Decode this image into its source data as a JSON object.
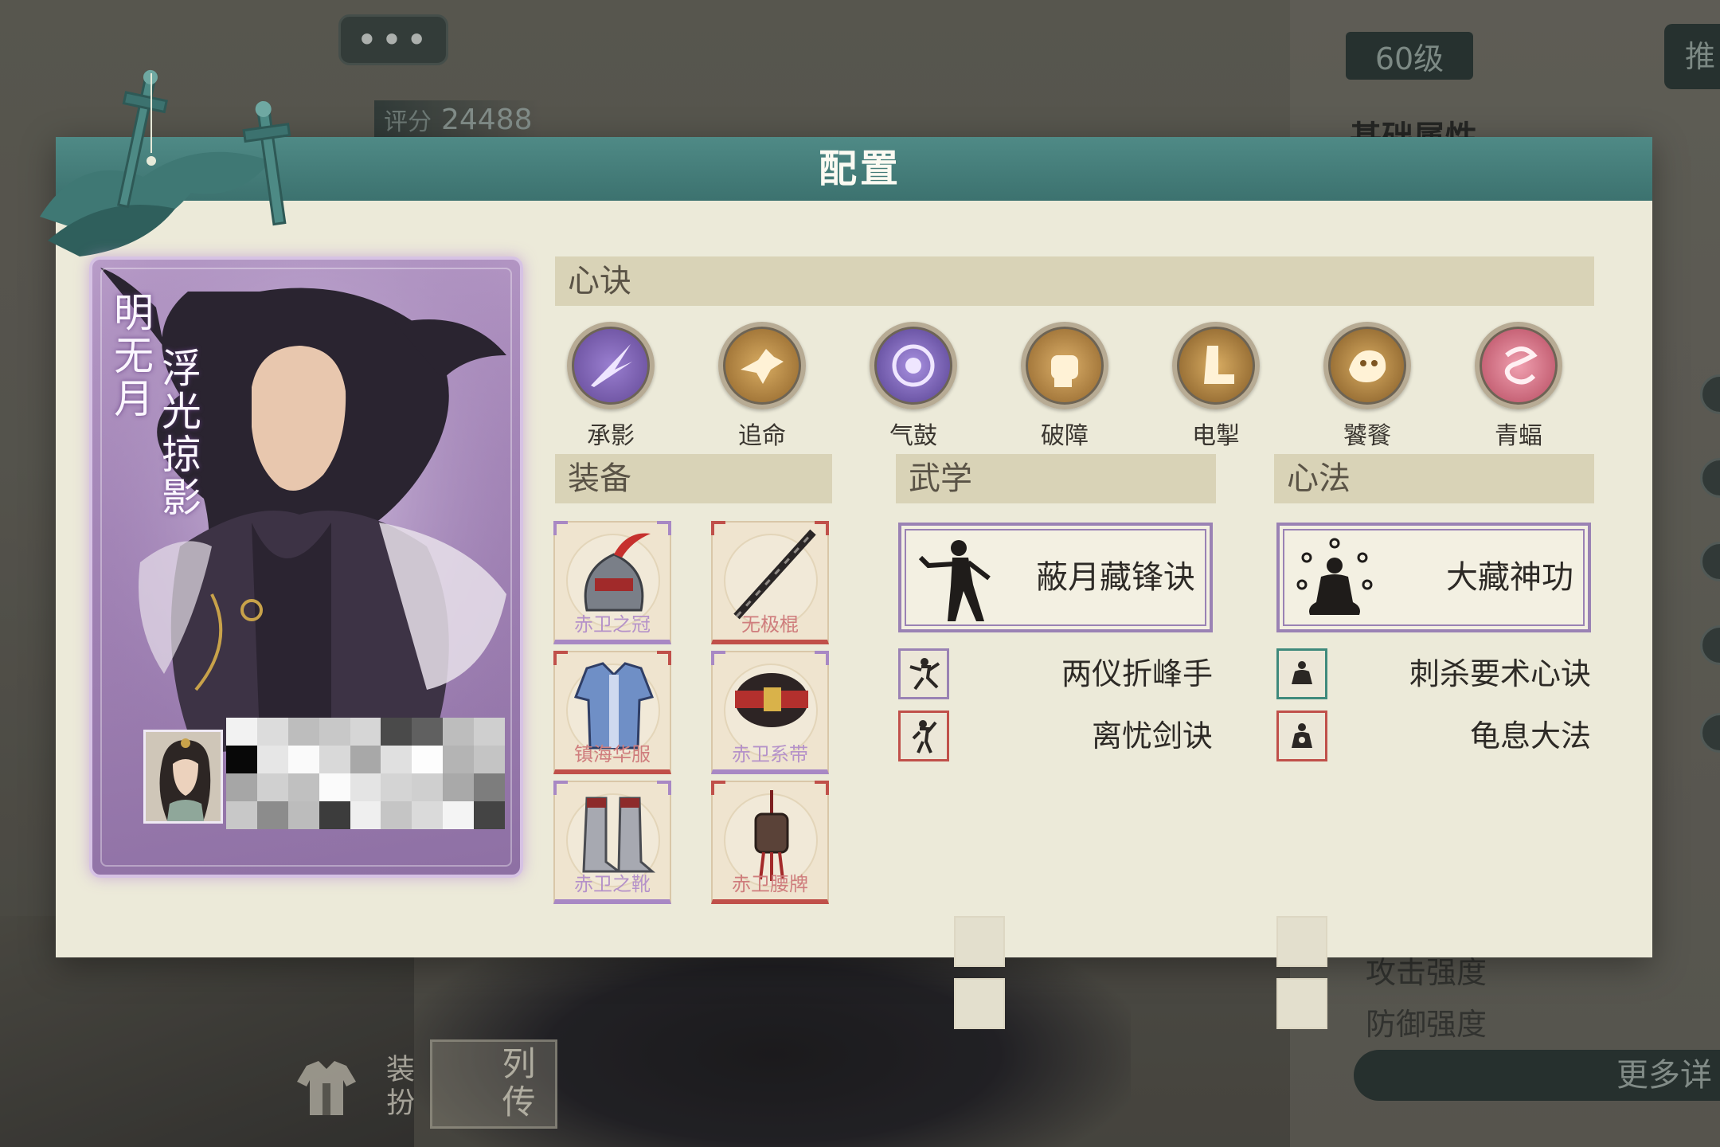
{
  "background": {
    "chat_bubble": "•••",
    "level": "60级",
    "top_right_tab": "推",
    "score_label": "评分",
    "score_value": "24488",
    "basic_attr_title": "基础属性",
    "attrs": [
      "攻击强度",
      "防御强度"
    ],
    "more_detail": "更多详",
    "dress_button": "装扮",
    "biography_button": "列传"
  },
  "modal": {
    "title": "配置"
  },
  "character": {
    "name": "明无月",
    "title": "浮光掠影"
  },
  "sections": {
    "xinjue": "心诀",
    "equipment": "装备",
    "wuxue": "武学",
    "xinfa": "心法"
  },
  "xinjue_skills": [
    {
      "label": "承影",
      "icon": "lightning-fan-icon",
      "color": "#8a6bc0"
    },
    {
      "label": "追命",
      "icon": "dash-strike-icon",
      "color": "#c99a4c"
    },
    {
      "label": "气鼓",
      "icon": "vortex-icon",
      "color": "#7b5fb8"
    },
    {
      "label": "破障",
      "icon": "fist-icon",
      "color": "#c99a4c"
    },
    {
      "label": "电掣",
      "icon": "boot-icon",
      "color": "#c99a4c"
    },
    {
      "label": "饕餮",
      "icon": "beast-icon",
      "color": "#c99a4c"
    },
    {
      "label": "青蝠",
      "icon": "swirl-icon",
      "color": "#d9768a"
    }
  ],
  "equipment": [
    {
      "label": "赤卫之冠",
      "icon": "helmet-icon",
      "rarity": "purple"
    },
    {
      "label": "无极棍",
      "icon": "staff-icon",
      "rarity": "red"
    },
    {
      "label": "镇海华服",
      "icon": "robe-icon",
      "rarity": "red"
    },
    {
      "label": "赤卫系带",
      "icon": "belt-icon",
      "rarity": "purple"
    },
    {
      "label": "赤卫之靴",
      "icon": "boots-icon",
      "rarity": "purple"
    },
    {
      "label": "赤卫腰牌",
      "icon": "token-icon",
      "rarity": "red"
    }
  ],
  "wuxue": {
    "main": "蔽月藏锋诀",
    "subs": [
      {
        "label": "两仪折峰手",
        "frame": "purple"
      },
      {
        "label": "离忧剑诀",
        "frame": "red"
      }
    ]
  },
  "xinfa": {
    "main": "大藏神功",
    "subs": [
      {
        "label": "刺杀要术心诀",
        "frame": "teal"
      },
      {
        "label": "龟息大法",
        "frame": "red"
      }
    ]
  }
}
